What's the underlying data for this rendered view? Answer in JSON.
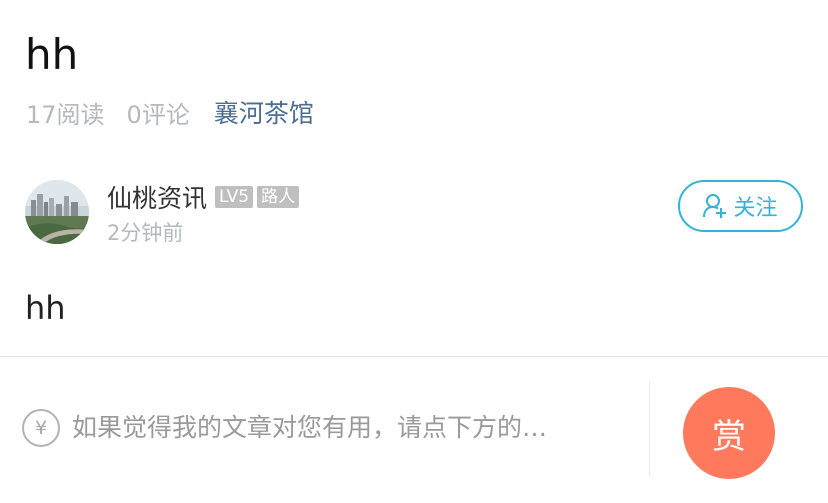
{
  "post": {
    "title": "hh",
    "read_count": "17阅读",
    "comment_count": "0评论",
    "forum": "襄河茶馆",
    "body": "hh"
  },
  "author": {
    "name": "仙桃资讯",
    "level": "LV5",
    "rank": "路人",
    "time": "2分钟前",
    "avatar_icon": "city-photo-avatar"
  },
  "follow": {
    "label": "关注",
    "icon": "add-user-icon",
    "color": "#34b3d9"
  },
  "reward": {
    "currency_symbol": "¥",
    "hint": "如果觉得我的文章对您有用，请点下方的…",
    "button_label": "赏",
    "button_color": "#ff7a5c"
  },
  "colors": {
    "forum_link": "#4c6e92",
    "meta_text": "#b5b8bd",
    "badge_bg": "#bfbfbf"
  }
}
